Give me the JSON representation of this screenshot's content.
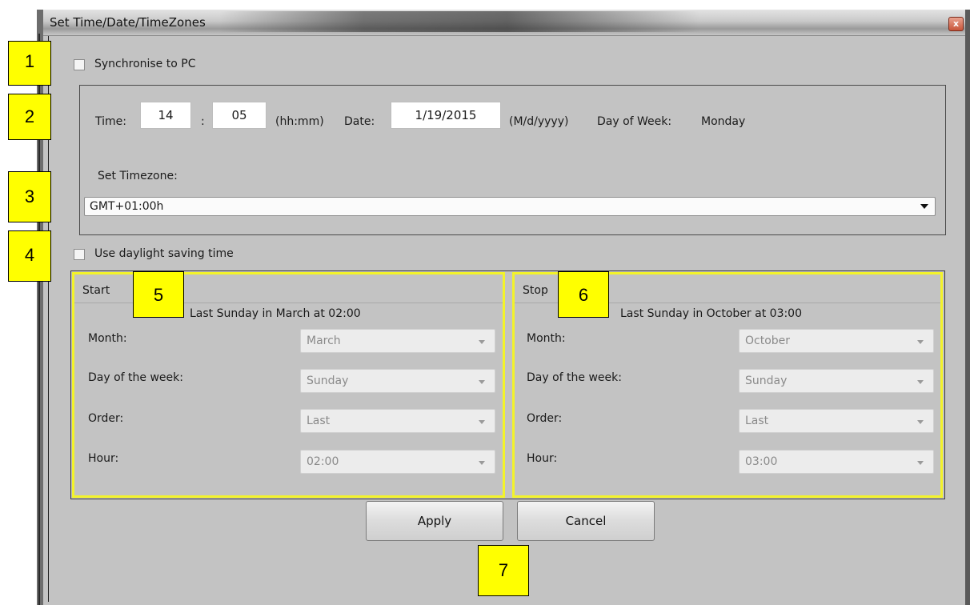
{
  "window": {
    "title": "Set Time/Date/TimeZones",
    "close_glyph": "x"
  },
  "sync": {
    "label": "Synchronise to PC",
    "checked": false
  },
  "datetime": {
    "time_label": "Time:",
    "hour": "14",
    "separator": ":",
    "minute": "05",
    "time_format": "(hh:mm)",
    "date_label": "Date:",
    "date": "1/19/2015",
    "date_format": "(M/d/yyyy)",
    "dow_label": "Day of Week:",
    "dow_value": "Monday",
    "timezone_label": "Set Timezone:",
    "timezone_value": "GMT+01:00h"
  },
  "dst": {
    "label": "Use daylight saving time",
    "checked": false
  },
  "start_panel": {
    "title": "Start",
    "summary": "Last Sunday in March at 02:00",
    "month_label": "Month:",
    "month_value": "March",
    "day_label": "Day of the week:",
    "day_value": "Sunday",
    "order_label": "Order:",
    "order_value": "Last",
    "hour_label": "Hour:",
    "hour_value": "02:00"
  },
  "stop_panel": {
    "title": "Stop",
    "summary": "Last Sunday in October at 03:00",
    "month_label": "Month:",
    "month_value": "October",
    "day_label": "Day of the week:",
    "day_value": "Sunday",
    "order_label": "Order:",
    "order_value": "Last",
    "hour_label": "Hour:",
    "hour_value": "03:00"
  },
  "buttons": {
    "apply": "Apply",
    "cancel": "Cancel"
  },
  "callouts": [
    "1",
    "2",
    "3",
    "4",
    "5",
    "6",
    "7"
  ],
  "colors": {
    "highlight": "#f3f32a",
    "callout_fill": "#ffff00",
    "dialog_bg": "#c3c3c3"
  }
}
